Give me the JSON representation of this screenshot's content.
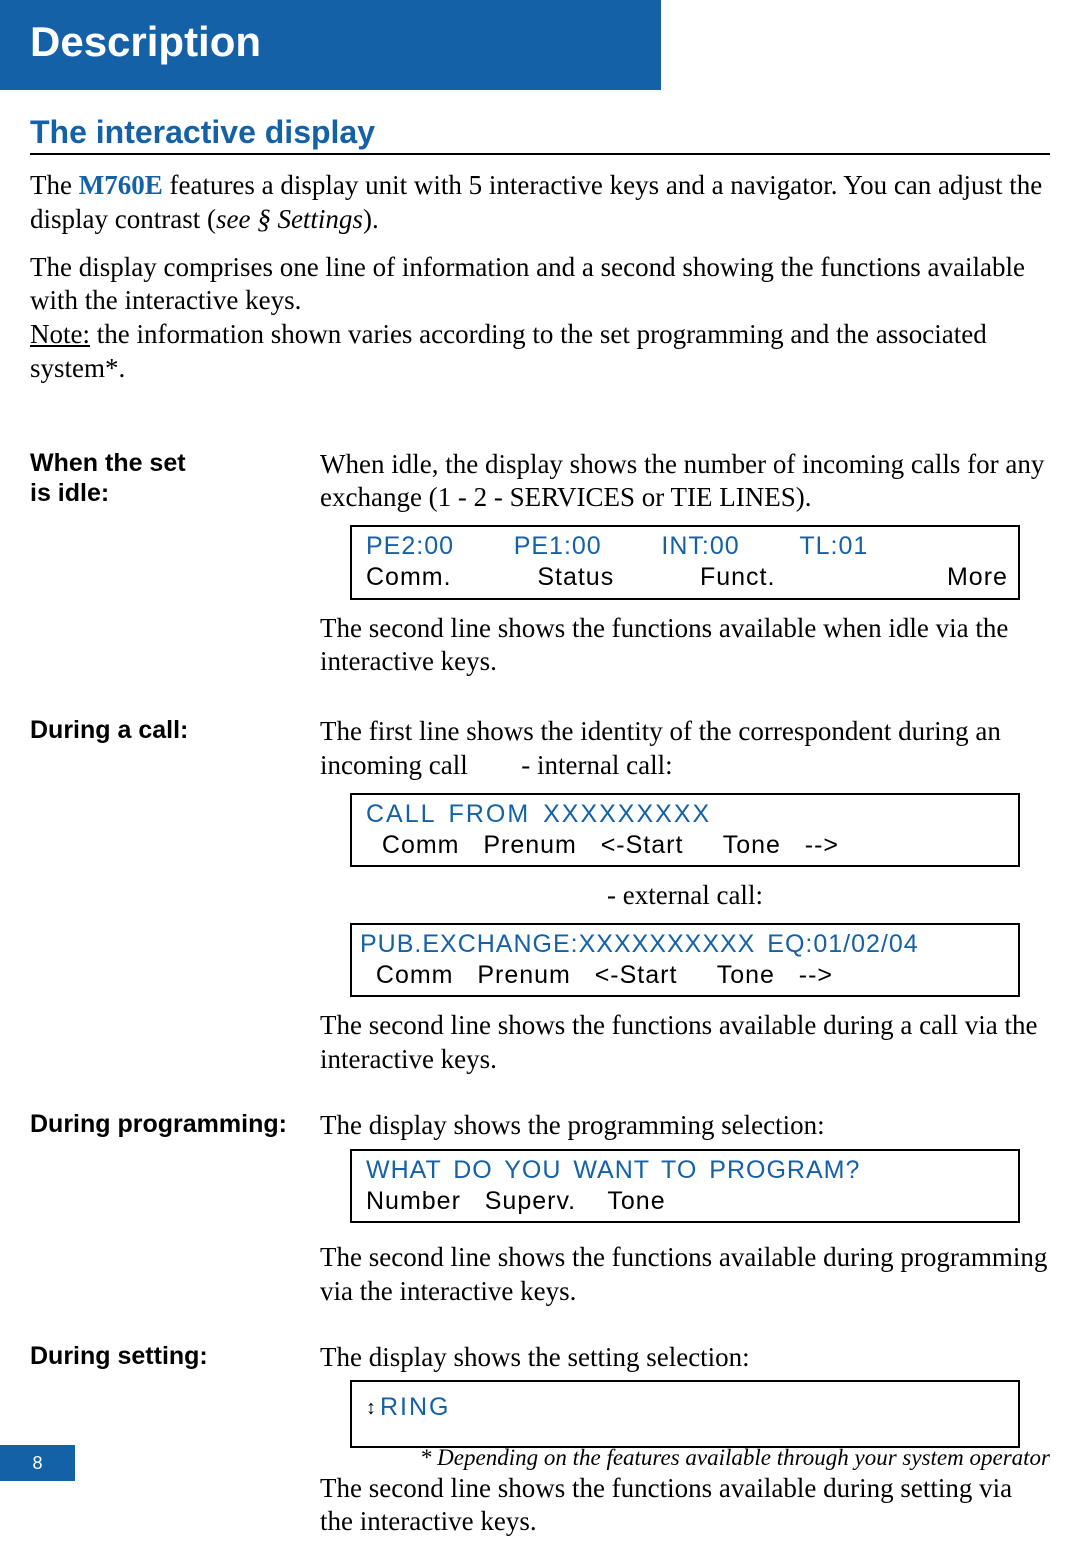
{
  "header": {
    "title": "Description"
  },
  "section": {
    "title": "The interactive display",
    "intro1_before": "The ",
    "product": "M760E",
    "intro1_after": " features a display unit with 5 interactive keys and a navigator. You can adjust the display contrast (",
    "intro1_italic": "see § Settings",
    "intro1_after2": ").",
    "intro2": "The display comprises one line of information and a second showing the functions available with the interactive keys.",
    "note_label": "Note:",
    "note_text": " the information shown varies according to the set programming and the associated system*."
  },
  "idle": {
    "heading1": "When the set",
    "heading2": "is idle:",
    "text1": "When idle, the display shows the number of incoming calls for any exchange (1 - 2 - SERVICES or TIE LINES).",
    "display": {
      "r1c1": "PE2:00",
      "r1c2": "PE1:00",
      "r1c3": "INT:00",
      "r1c4": "TL:01",
      "r1c5": "",
      "r2c1": "Comm.",
      "r2c2": "Status",
      "r2c3": "Funct.",
      "r2c4": "",
      "r2c5": "More"
    },
    "text2": "The second line shows the functions available when idle via the interactive keys."
  },
  "call": {
    "heading": "During a call:",
    "text1a": "The first line shows the identity of the correspondent during an incoming call",
    "text1b": "- internal call:",
    "display1": {
      "line1": "CALL FROM XXXXXXXXX",
      "line2": "  Comm   Prenum   <-Start     Tone   -->"
    },
    "mid": "- external call:",
    "display2": {
      "line1": "PUB.EXCHANGE:XXXXXXXXXX EQ:01/02/04",
      "line2": "  Comm   Prenum   <-Start     Tone   -->"
    },
    "text2": "The second line shows the functions available during a call via the interactive keys."
  },
  "programming": {
    "heading": "During programming:",
    "text1": "The display shows the programming selection:",
    "display": {
      "line1": "WHAT DO YOU WANT TO PROGRAM?",
      "line2": "Number   Superv.    Tone"
    },
    "text2": "The second line shows the functions available during programming via the interactive keys."
  },
  "setting": {
    "heading": "During setting:",
    "text1": "The display shows the setting selection:",
    "display": {
      "line1": "RING"
    },
    "text2": "The second line shows the functions available during setting via the interactive keys."
  },
  "footnote": "* Depending on the features available through your system operator",
  "page_number": "8"
}
